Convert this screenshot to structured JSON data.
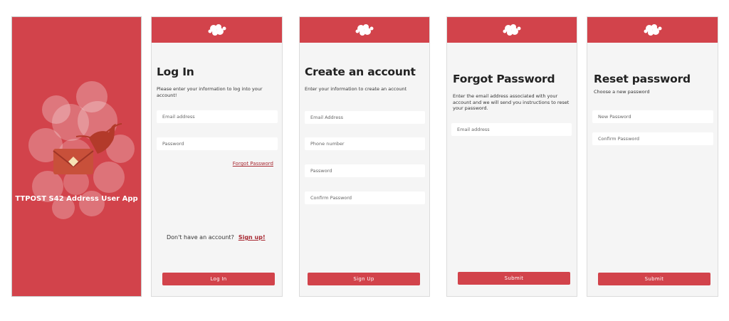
{
  "splash": {
    "app_name": "TTPOST S42 Address User App"
  },
  "login": {
    "title": "Log In",
    "subtitle": "Please enter your information to log into your account!",
    "email_placeholder": "Email address",
    "password_placeholder": "Password",
    "forgot_link": "Forgot Password",
    "no_account_text": "Don't have an account?",
    "signup_link": "Sign up!",
    "login_button": "Log In"
  },
  "signup": {
    "title": "Create an account",
    "subtitle": "Enter your information to create an account",
    "email_placeholder": "Email Address",
    "phone_placeholder": "Phone number",
    "password_placeholder": "Password",
    "confirm_placeholder": "Confirm Password",
    "signup_button": "Sign Up"
  },
  "forgot": {
    "title": "Forgot Password",
    "subtitle": "Enter the email address associated with your account and we will send you instructions to reset your password.",
    "email_placeholder": "Email address",
    "submit_button": "Submit"
  },
  "reset": {
    "title": "Reset password",
    "subtitle": "Choose a new password",
    "new_password_placeholder": "New Password",
    "confirm_placeholder": "Confirm Password",
    "submit_button": "Submit"
  },
  "colors": {
    "brand_red": "#d2434b",
    "link_red": "#a82a33",
    "screen_bg": "#f5f5f5"
  },
  "icons": {
    "header_logo": "flower-logo-icon",
    "splash_art": "hummingbird-envelope-logo-icon"
  }
}
